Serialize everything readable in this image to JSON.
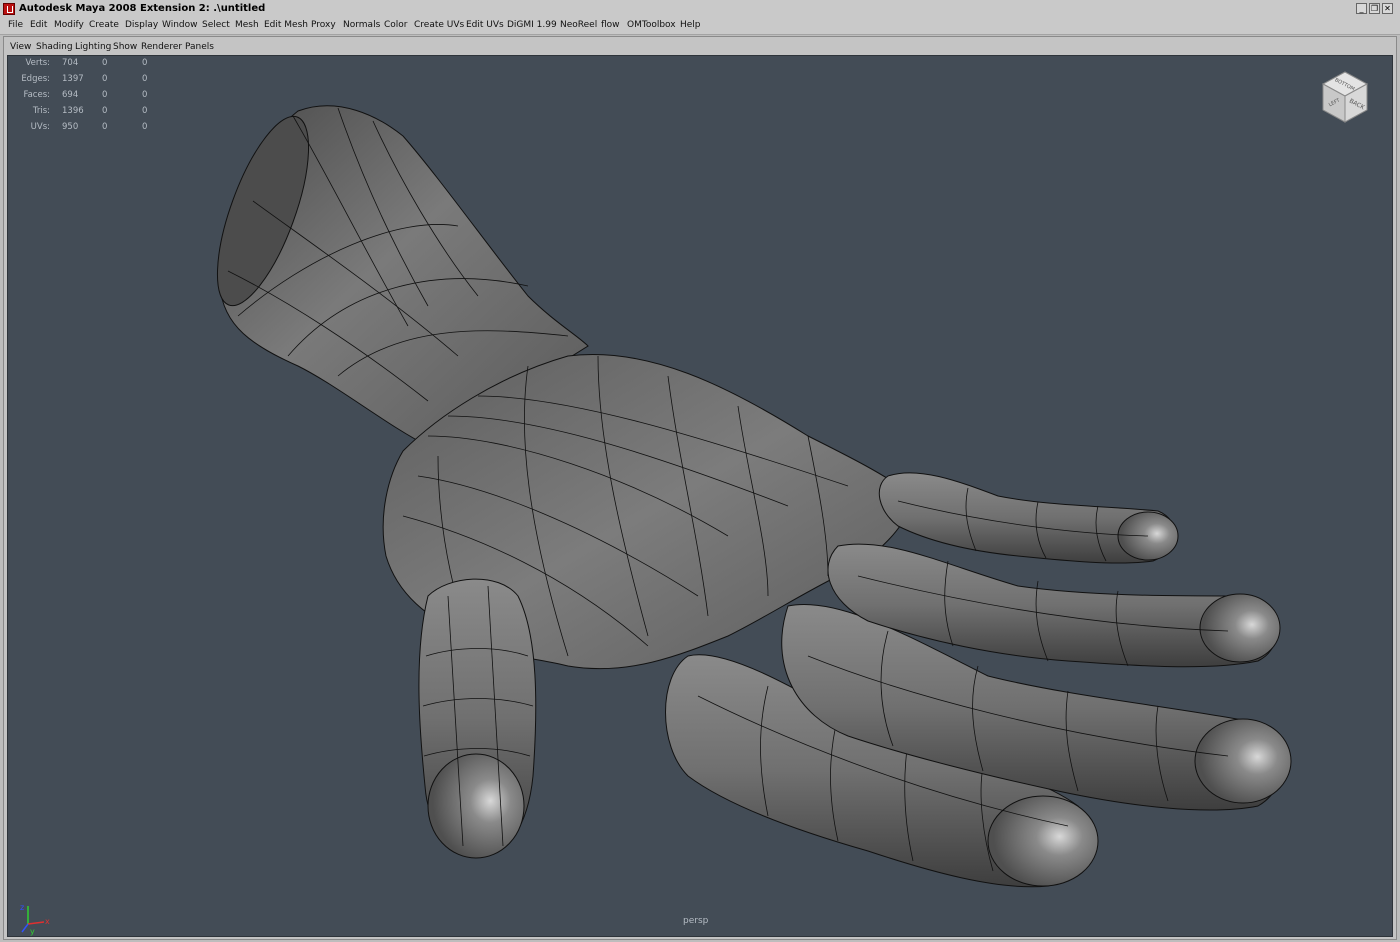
{
  "window": {
    "title": "Autodesk Maya 2008 Extension 2: .\\untitled",
    "controls": [
      "minimize",
      "restore",
      "close"
    ]
  },
  "menubar": {
    "items": [
      "File",
      "Edit",
      "Modify",
      "Create",
      "Display",
      "Window",
      "Select",
      "Mesh",
      "Edit Mesh",
      "Proxy",
      "Normals",
      "Color",
      "Create UVs",
      "Edit UVs",
      "DiGMI 1.99",
      "NeoReel",
      "flow",
      "OMToolbox",
      "Help"
    ]
  },
  "panel_menu": {
    "items": [
      "View",
      "Shading",
      "Lighting",
      "Show",
      "Renderer",
      "Panels"
    ]
  },
  "hud": {
    "stats": [
      {
        "label": "Verts:",
        "v1": "704",
        "v2": "0",
        "v3": "0"
      },
      {
        "label": "Edges:",
        "v1": "1397",
        "v2": "0",
        "v3": "0"
      },
      {
        "label": "Faces:",
        "v1": "694",
        "v2": "0",
        "v3": "0"
      },
      {
        "label": "Tris:",
        "v1": "1396",
        "v2": "0",
        "v3": "0"
      },
      {
        "label": "UVs:",
        "v1": "950",
        "v2": "0",
        "v3": "0"
      }
    ],
    "camera": "persp"
  },
  "viewcube": {
    "faces": [
      "BOTTOM",
      "BACK",
      "LEFT"
    ]
  },
  "axis_gizmo": {
    "x": "x",
    "y": "y",
    "z": "z",
    "x_color": "#e03030",
    "y_color": "#30d030",
    "z_color": "#3050ff"
  },
  "colors": {
    "viewport_bg": "#434c56",
    "ui_gray": "#c9c9c9",
    "mesh": "#6c6c6c"
  }
}
